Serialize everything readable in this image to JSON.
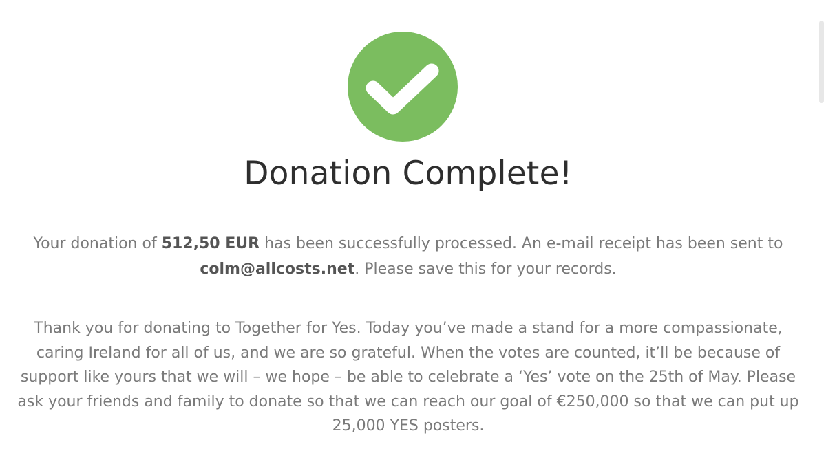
{
  "icon": {
    "name": "checkmark-icon",
    "circle_color": "#7bbd5f",
    "mark_color": "#ffffff"
  },
  "title": "Donation Complete!",
  "confirmation": {
    "prefix": "Your donation of ",
    "amount": "512,50 EUR",
    "middle": " has been successfully processed. An e-mail receipt has been sent to ",
    "email": "colm@allcosts.net",
    "suffix": ". Please save this for your records."
  },
  "thank_you": "Thank you for donating to Together for Yes. Today you’ve made a stand for a more compassionate, caring Ireland for all of us, and we are so grateful. When the votes are counted, it’ll be because of support like yours that we will – we hope – be able to celebrate a ‘Yes’ vote on the 25th of May. Please ask your friends and family to donate so that we can reach our goal of €250,000 so that we can put up 25,000 YES posters."
}
